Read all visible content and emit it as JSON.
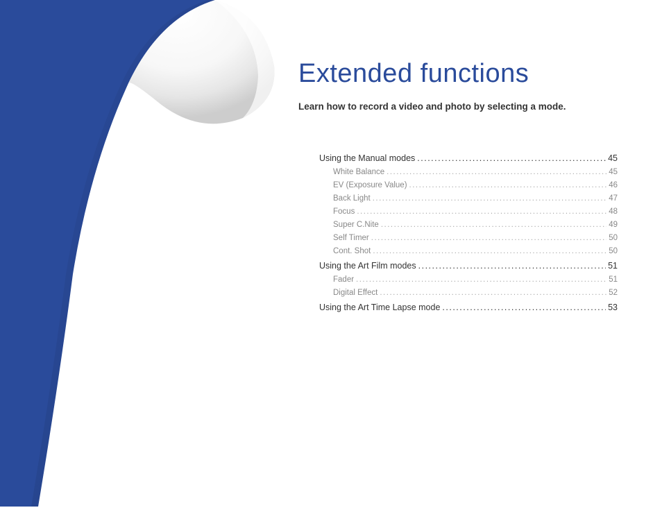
{
  "chapter": {
    "title": "Extended functions",
    "subtitle": "Learn how to record a video and photo by selecting a mode."
  },
  "toc": {
    "sections": [
      {
        "label": "Using the Manual modes",
        "page": "45",
        "items": [
          {
            "label": "White Balance",
            "page": "45"
          },
          {
            "label": "EV (Exposure Value)",
            "page": "46"
          },
          {
            "label": "Back Light",
            "page": "47"
          },
          {
            "label": "Focus",
            "page": "48"
          },
          {
            "label": "Super C.Nite",
            "page": "49"
          },
          {
            "label": "Self Timer",
            "page": "50"
          },
          {
            "label": "Cont. Shot",
            "page": "50"
          }
        ]
      },
      {
        "label": "Using the Art Film modes",
        "page": "51",
        "items": [
          {
            "label": "Fader",
            "page": "51"
          },
          {
            "label": "Digital Effect",
            "page": "52"
          }
        ]
      },
      {
        "label": "Using the Art Time Lapse mode",
        "page": "53",
        "items": []
      }
    ]
  }
}
